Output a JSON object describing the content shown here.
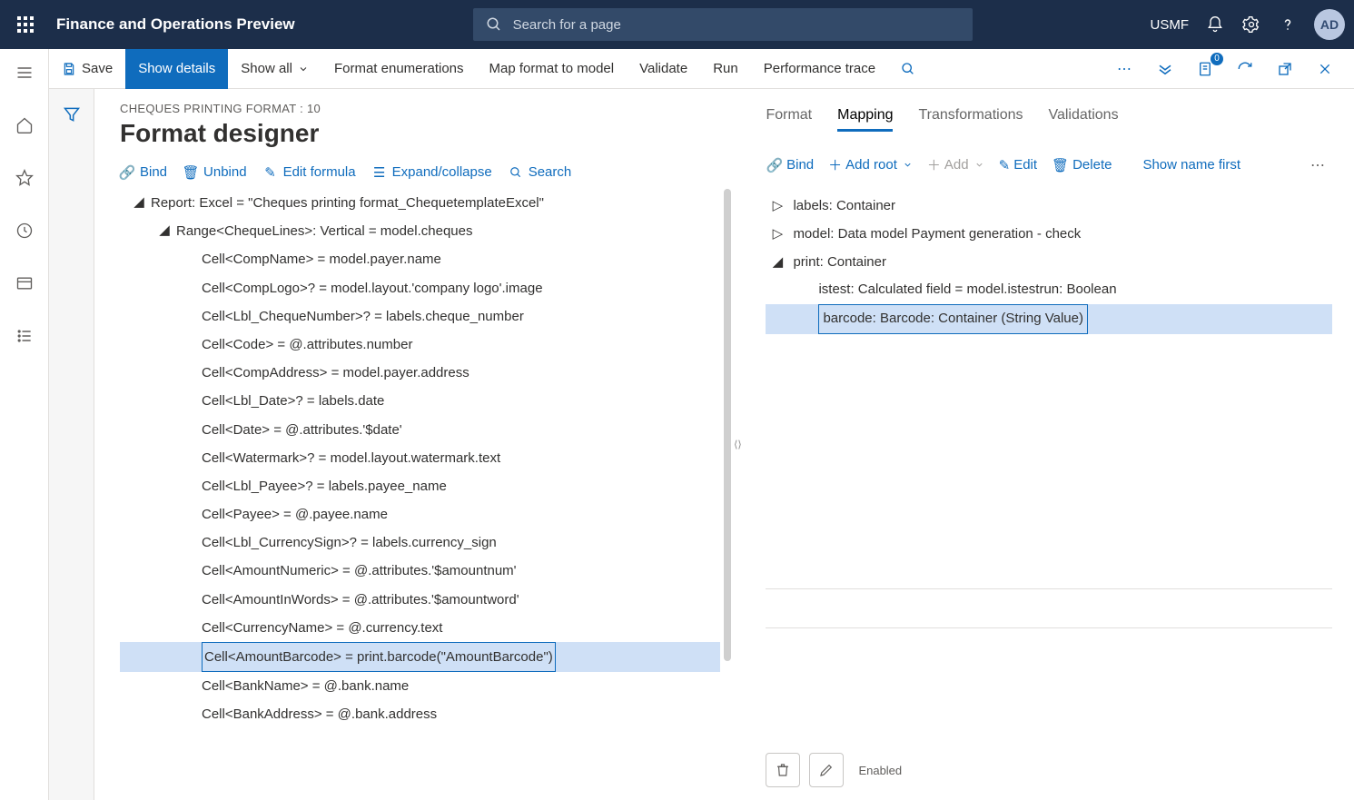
{
  "topbar": {
    "title": "Finance and Operations Preview",
    "search_placeholder": "Search for a page",
    "company": "USMF",
    "avatar": "AD"
  },
  "actionbar": {
    "save": "Save",
    "show_details": "Show details",
    "show_all": "Show all",
    "format_enum": "Format enumerations",
    "map_format": "Map format to model",
    "validate": "Validate",
    "run": "Run",
    "perf": "Performance trace",
    "badge": "0"
  },
  "page": {
    "crumb": "CHEQUES PRINTING FORMAT : 10",
    "title": "Format designer"
  },
  "tools": {
    "bind": "Bind",
    "unbind": "Unbind",
    "edit_formula": "Edit formula",
    "expand": "Expand/collapse",
    "search": "Search"
  },
  "tree": [
    {
      "indent": 0,
      "tw": "◢",
      "text": "Report: Excel = \"Cheques printing format_ChequetemplateExcel\""
    },
    {
      "indent": 1,
      "tw": "◢",
      "text": "Range<ChequeLines>: Vertical = model.cheques"
    },
    {
      "indent": 2,
      "tw": "",
      "text": "Cell<CompName> = model.payer.name"
    },
    {
      "indent": 2,
      "tw": "",
      "text": "Cell<CompLogo>? = model.layout.'company logo'.image"
    },
    {
      "indent": 2,
      "tw": "",
      "text": "Cell<Lbl_ChequeNumber>? = labels.cheque_number"
    },
    {
      "indent": 2,
      "tw": "",
      "text": "Cell<Code> = @.attributes.number"
    },
    {
      "indent": 2,
      "tw": "",
      "text": "Cell<CompAddress> = model.payer.address"
    },
    {
      "indent": 2,
      "tw": "",
      "text": "Cell<Lbl_Date>? = labels.date"
    },
    {
      "indent": 2,
      "tw": "",
      "text": "Cell<Date> = @.attributes.'$date'"
    },
    {
      "indent": 2,
      "tw": "",
      "text": "Cell<Watermark>? = model.layout.watermark.text"
    },
    {
      "indent": 2,
      "tw": "",
      "text": "Cell<Lbl_Payee>? = labels.payee_name"
    },
    {
      "indent": 2,
      "tw": "",
      "text": "Cell<Payee> = @.payee.name"
    },
    {
      "indent": 2,
      "tw": "",
      "text": "Cell<Lbl_CurrencySign>? = labels.currency_sign"
    },
    {
      "indent": 2,
      "tw": "",
      "text": "Cell<AmountNumeric> = @.attributes.'$amountnum'"
    },
    {
      "indent": 2,
      "tw": "",
      "text": "Cell<AmountInWords> = @.attributes.'$amountword'"
    },
    {
      "indent": 2,
      "tw": "",
      "text": "Cell<CurrencyName> = @.currency.text"
    },
    {
      "indent": 2,
      "tw": "",
      "text": "Cell<AmountBarcode> = print.barcode(\"AmountBarcode\")",
      "sel": true,
      "ul": true
    },
    {
      "indent": 2,
      "tw": "",
      "text": "Cell<BankName> = @.bank.name"
    },
    {
      "indent": 2,
      "tw": "",
      "text": "Cell<BankAddress> = @.bank.address"
    }
  ],
  "tabs": {
    "format": "Format",
    "mapping": "Mapping",
    "transformations": "Transformations",
    "validations": "Validations"
  },
  "map_tools": {
    "bind": "Bind",
    "add_root": "Add root",
    "add": "Add",
    "edit": "Edit",
    "delete": "Delete",
    "show_name": "Show name first"
  },
  "map_tree": [
    {
      "indent": 0,
      "tw": "▷",
      "text": "labels: Container"
    },
    {
      "indent": 0,
      "tw": "▷",
      "text": "model: Data model Payment generation - check"
    },
    {
      "indent": 0,
      "tw": "◢",
      "text": "print: Container"
    },
    {
      "indent": 1,
      "tw": "",
      "text": "istest: Calculated field = model.istestrun: Boolean"
    },
    {
      "indent": 1,
      "tw": "",
      "text": "barcode: Barcode: Container (String Value)",
      "sel": true,
      "ul": true
    }
  ],
  "bottom": {
    "enabled": "Enabled"
  }
}
